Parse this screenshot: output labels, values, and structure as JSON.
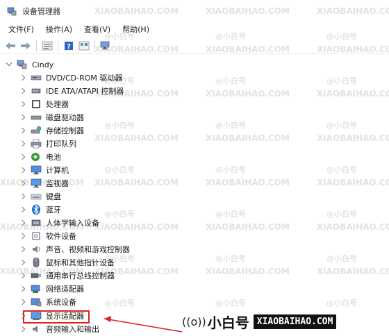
{
  "window": {
    "title": "设备管理器"
  },
  "menu": [
    "文件(F)",
    "操作(A)",
    "查看(V)",
    "帮助(H)"
  ],
  "tree": {
    "root": "Cindy",
    "items": [
      {
        "label": "DVD/CD-ROM 驱动器",
        "icon": "disc-drive-icon"
      },
      {
        "label": "IDE ATA/ATAPI 控制器",
        "icon": "controller-icon"
      },
      {
        "label": "处理器",
        "icon": "processor-icon"
      },
      {
        "label": "磁盘驱动器",
        "icon": "disk-drive-icon"
      },
      {
        "label": "存储控制器",
        "icon": "storage-controller-icon"
      },
      {
        "label": "打印队列",
        "icon": "printer-icon"
      },
      {
        "label": "电池",
        "icon": "battery-icon"
      },
      {
        "label": "计算机",
        "icon": "computer-icon"
      },
      {
        "label": "监视器",
        "icon": "monitor-icon"
      },
      {
        "label": "键盘",
        "icon": "keyboard-icon"
      },
      {
        "label": "蓝牙",
        "icon": "bluetooth-icon"
      },
      {
        "label": "人体学输入设备",
        "icon": "hid-icon"
      },
      {
        "label": "软件设备",
        "icon": "software-device-icon"
      },
      {
        "label": "声音、视频和游戏控制器",
        "icon": "speaker-icon"
      },
      {
        "label": "鼠标和其他指针设备",
        "icon": "mouse-icon"
      },
      {
        "label": "通用串行总线控制器",
        "icon": "usb-icon"
      },
      {
        "label": "网络适配器",
        "icon": "network-adapter-icon"
      },
      {
        "label": "系统设备",
        "icon": "system-device-icon"
      },
      {
        "label": "显示适配器",
        "icon": "display-adapter-icon",
        "highlighted": true
      },
      {
        "label": "音频输入和输出",
        "icon": "audio-io-icon"
      }
    ]
  },
  "watermark": {
    "text": "XIAOBAIHAO.COM",
    "cn": "@小白号"
  },
  "brand": {
    "wave": "((o))",
    "cn": "小白号",
    "url": "XIAOBAIHAO.COM"
  },
  "colors": {
    "highlight": "#e0201c",
    "arrow": "#e0201c",
    "icon_blue": "#2f7bd8"
  }
}
